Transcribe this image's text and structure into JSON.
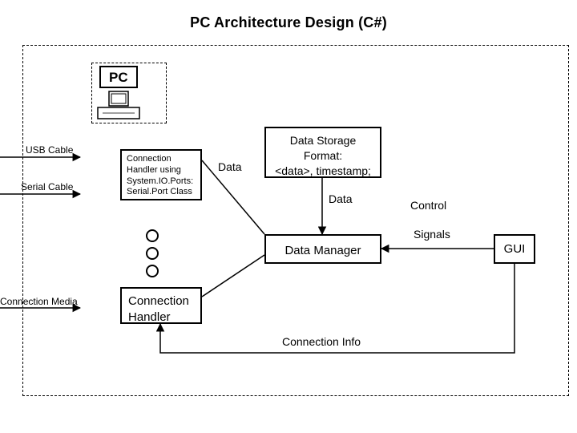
{
  "title": "PC Architecture Design (C#)",
  "pc": {
    "label": "PC"
  },
  "inputs": {
    "usb": "USB Cable",
    "serial": "Serial Cable",
    "media": "Connection Media"
  },
  "boxes": {
    "conn_handler1": "Connection\nHandler using\nSystem.IO.Ports:\nSerial.Port Class",
    "data_storage": "Data Storage\nFormat:\n<data>, timestamp;",
    "data_manager": "Data Manager",
    "conn_handler2": "Connection\nHandler",
    "gui": "GUI"
  },
  "edge_labels": {
    "data_to_storage": "Data",
    "storage_to_manager": "Data",
    "control": "Control",
    "signals": "Signals",
    "conn_info": "Connection Info"
  }
}
